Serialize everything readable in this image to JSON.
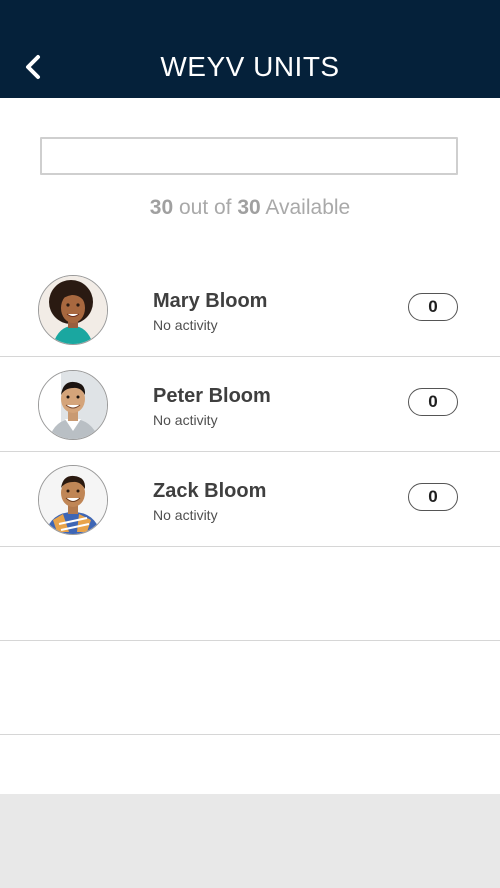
{
  "header": {
    "title": "WEYV UNITS",
    "back_icon": "chevron-left-icon",
    "background": "#05213a"
  },
  "search": {
    "value": "",
    "placeholder": ""
  },
  "availability": {
    "available": "30",
    "mid_text": " out of ",
    "total": "30",
    "suffix": " Available"
  },
  "members": [
    {
      "name": "Mary Bloom",
      "activity": "No activity",
      "count": "0",
      "avatar": "woman-portrait"
    },
    {
      "name": "Peter Bloom",
      "activity": "No activity",
      "count": "0",
      "avatar": "man-portrait"
    },
    {
      "name": "Zack Bloom",
      "activity": "No activity",
      "count": "0",
      "avatar": "boy-portrait"
    }
  ]
}
